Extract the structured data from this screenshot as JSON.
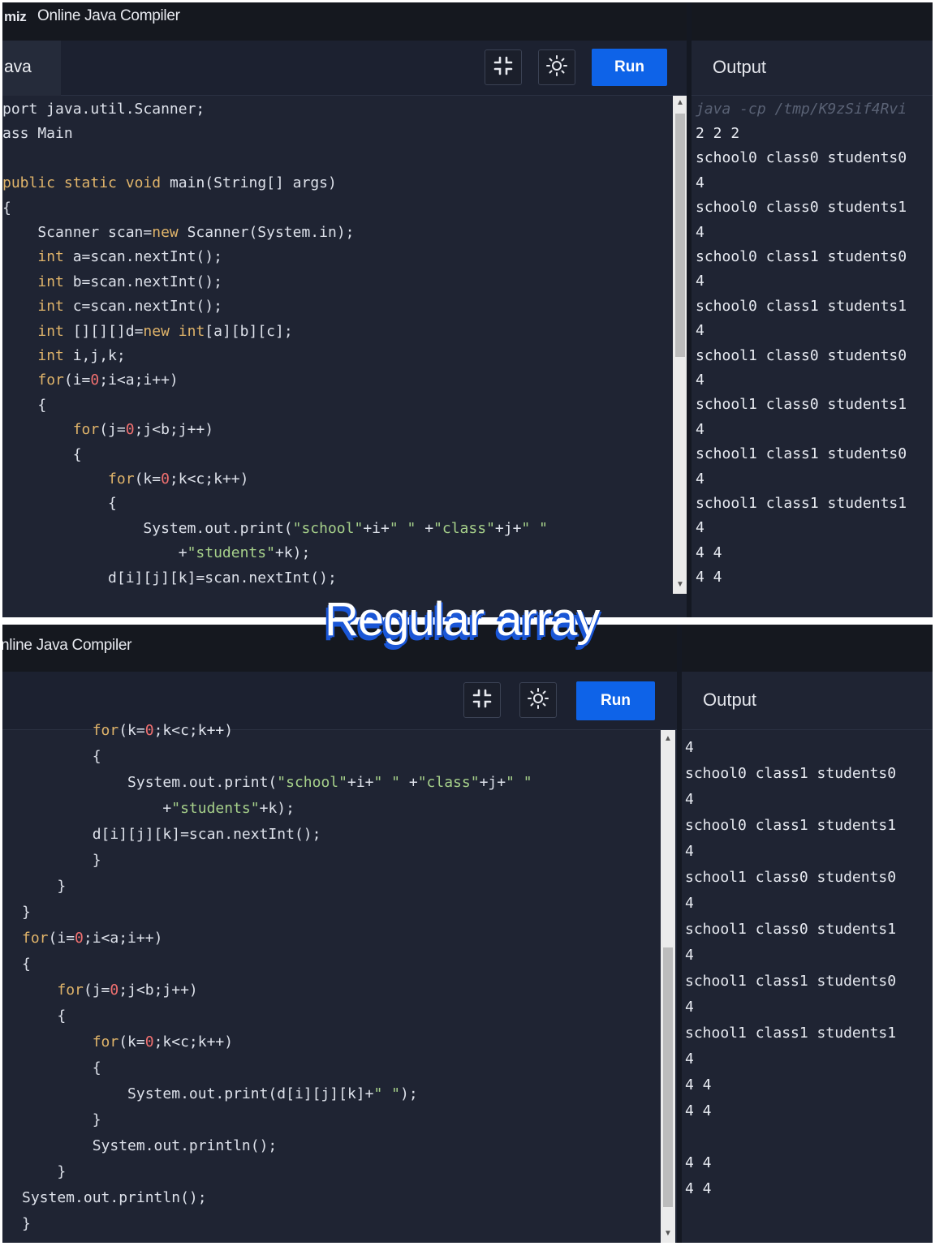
{
  "overlay_title": "Regular array",
  "colors": {
    "run_button": "#0e63e8",
    "editor_bg": "#1f2433",
    "keyword": "#e0b46a",
    "string": "#a6d08a",
    "number": "#f07070"
  },
  "top": {
    "logo": "miz",
    "title": "Online Java Compiler",
    "file_tab": "ava",
    "icons": [
      "fullscreen-exit-icon",
      "theme-sun-icon"
    ],
    "run_label": "Run",
    "output_label": "Output",
    "code_lines": [
      "port java.util.Scanner;",
      "ass Main",
      "",
      "public static void main(String[] args)",
      "{",
      "    Scanner scan=new Scanner(System.in);",
      "    int a=scan.nextInt();",
      "    int b=scan.nextInt();",
      "    int c=scan.nextInt();",
      "    int [][][]d=new int[a][b][c];",
      "    int i,j,k;",
      "    for(i=0;i<a;i++)",
      "    {",
      "        for(j=0;j<b;j++)",
      "        {",
      "            for(k=0;k<c;k++)",
      "            {",
      "                System.out.print(\"school\"+i+\" \" +\"class\"+j+\" \"",
      "                    +\"students\"+k);",
      "            d[i][j][k]=scan.nextInt();"
    ],
    "output_command": "java -cp /tmp/K9zSif4Rvi",
    "output_lines": [
      "2 2 2",
      "school0 class0 students0",
      "4",
      "school0 class0 students1",
      "4",
      "school0 class1 students0",
      "4",
      "school0 class1 students1",
      "4",
      "school1 class0 students0",
      "4",
      "school1 class0 students1",
      "4",
      "school1 class1 students0",
      "4",
      "school1 class1 students1",
      "4",
      "4 4",
      "4 4"
    ]
  },
  "bottom": {
    "title": "Online Java Compiler",
    "title_partial": "nline Java Compiler",
    "icons": [
      "fullscreen-exit-icon",
      "theme-sun-icon"
    ],
    "run_label": "Run",
    "output_label": "Output",
    "code_lines": [
      "        for(k=0;k<c;k++)",
      "        {",
      "            System.out.print(\"school\"+i+\" \" +\"class\"+j+\" \"",
      "                +\"students\"+k);",
      "        d[i][j][k]=scan.nextInt();",
      "        }",
      "    }",
      "}",
      "for(i=0;i<a;i++)",
      "{",
      "    for(j=0;j<b;j++)",
      "    {",
      "        for(k=0;k<c;k++)",
      "        {",
      "            System.out.print(d[i][j][k]+\" \");",
      "        }",
      "        System.out.println();",
      "    }",
      "System.out.println();",
      "}"
    ],
    "output_lines": [
      "4",
      "school0 class1 students0",
      "4",
      "school0 class1 students1",
      "4",
      "school1 class0 students0",
      "4",
      "school1 class0 students1",
      "4",
      "school1 class1 students0",
      "4",
      "school1 class1 students1",
      "4",
      "4 4",
      "4 4",
      "",
      "4 4",
      "4 4"
    ]
  }
}
